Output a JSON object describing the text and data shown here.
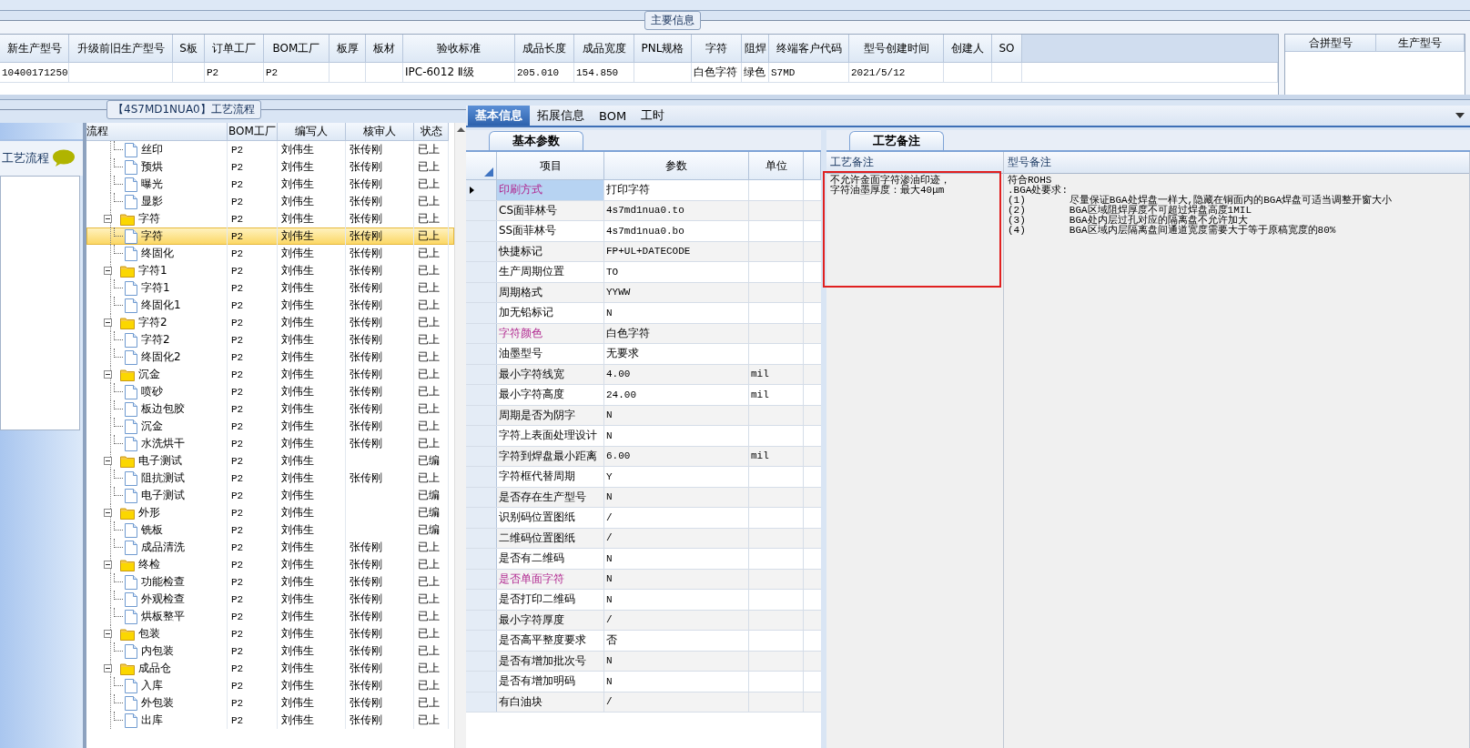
{
  "main_info": {
    "legend": "主要信息",
    "columns": [
      {
        "header": "新生产型号",
        "value": "10400171250"
      },
      {
        "header": "升级前旧生产型号"
      },
      {
        "header": "S板"
      },
      {
        "header": "订单工厂",
        "value": "P2"
      },
      {
        "header": "BOM工厂",
        "value": "P2"
      },
      {
        "header": "板厚"
      },
      {
        "header": "板材"
      },
      {
        "header": "验收标准",
        "value": "IPC-6012 Ⅱ级"
      },
      {
        "header": "成品长度",
        "value": "205.010"
      },
      {
        "header": "成品宽度",
        "value": "154.850"
      },
      {
        "header": "PNL规格"
      },
      {
        "header": "字符",
        "value": "白色字符"
      },
      {
        "header": "阻焊",
        "value": "绿色"
      },
      {
        "header": "终端客户代码",
        "value": "S7MD"
      },
      {
        "header": "型号创建时间",
        "value": "2021/5/12"
      },
      {
        "header": "创建人"
      },
      {
        "header": "SO"
      }
    ],
    "side_columns": [
      "合拼型号",
      "生产型号"
    ]
  },
  "sidebar": {
    "title": "工艺流程"
  },
  "process_flow": {
    "legend": "【4S7MD1NUA0】工艺流程",
    "columns": [
      "流程",
      "BOM工厂",
      "编写人",
      "核审人",
      "状态"
    ],
    "nodes": [
      {
        "children": [
          {
            "label": "丝印",
            "bom": "P2",
            "writer": "刘伟生",
            "reviewer": "张传刚",
            "status": "已上",
            "selected": false
          },
          {
            "label": "预烘",
            "bom": "P2",
            "writer": "刘伟生",
            "reviewer": "张传刚",
            "status": "已上",
            "selected": false
          },
          {
            "label": "曝光",
            "bom": "P2",
            "writer": "刘伟生",
            "reviewer": "张传刚",
            "status": "已上",
            "selected": false
          },
          {
            "label": "显影",
            "bom": "P2",
            "writer": "刘伟生",
            "reviewer": "张传刚",
            "status": "已上",
            "selected": false
          }
        ]
      },
      {
        "label": "字符",
        "bom": "P2",
        "writer": "刘伟生",
        "reviewer": "张传刚",
        "status": "已上",
        "selected": false,
        "expanded": true,
        "children": [
          {
            "label": "字符",
            "bom": "P2",
            "writer": "刘伟生",
            "reviewer": "张传刚",
            "status": "已上",
            "selected": true
          },
          {
            "label": "终固化",
            "bom": "P2",
            "writer": "刘伟生",
            "reviewer": "张传刚",
            "status": "已上",
            "selected": false
          }
        ]
      },
      {
        "label": "字符1",
        "bom": "P2",
        "writer": "刘伟生",
        "reviewer": "张传刚",
        "status": "已上",
        "selected": false,
        "expanded": true,
        "children": [
          {
            "label": "字符1",
            "bom": "P2",
            "writer": "刘伟生",
            "reviewer": "张传刚",
            "status": "已上",
            "selected": false
          },
          {
            "label": "终固化1",
            "bom": "P2",
            "writer": "刘伟生",
            "reviewer": "张传刚",
            "status": "已上",
            "selected": false
          }
        ]
      },
      {
        "label": "字符2",
        "bom": "P2",
        "writer": "刘伟生",
        "reviewer": "张传刚",
        "status": "已上",
        "selected": false,
        "expanded": true,
        "children": [
          {
            "label": "字符2",
            "bom": "P2",
            "writer": "刘伟生",
            "reviewer": "张传刚",
            "status": "已上",
            "selected": false
          },
          {
            "label": "终固化2",
            "bom": "P2",
            "writer": "刘伟生",
            "reviewer": "张传刚",
            "status": "已上",
            "selected": false
          }
        ]
      },
      {
        "label": "沉金",
        "bom": "P2",
        "writer": "刘伟生",
        "reviewer": "张传刚",
        "status": "已上",
        "selected": false,
        "expanded": true,
        "children": [
          {
            "label": "喷砂",
            "bom": "P2",
            "writer": "刘伟生",
            "reviewer": "张传刚",
            "status": "已上",
            "selected": false
          },
          {
            "label": "板边包胶",
            "bom": "P2",
            "writer": "刘伟生",
            "reviewer": "张传刚",
            "status": "已上",
            "selected": false
          },
          {
            "label": "沉金",
            "bom": "P2",
            "writer": "刘伟生",
            "reviewer": "张传刚",
            "status": "已上",
            "selected": false
          },
          {
            "label": "水洗烘干",
            "bom": "P2",
            "writer": "刘伟生",
            "reviewer": "张传刚",
            "status": "已上",
            "selected": false
          }
        ]
      },
      {
        "label": "电子测试",
        "bom": "P2",
        "writer": "刘伟生",
        "status": "已编",
        "selected": false,
        "expanded": true,
        "children": [
          {
            "label": "阻抗测试",
            "bom": "P2",
            "writer": "刘伟生",
            "reviewer": "张传刚",
            "status": "已上",
            "selected": false
          },
          {
            "label": "电子测试",
            "bom": "P2",
            "writer": "刘伟生",
            "status": "已编",
            "selected": false
          }
        ]
      },
      {
        "label": "外形",
        "bom": "P2",
        "writer": "刘伟生",
        "status": "已编",
        "selected": false,
        "expanded": true,
        "children": [
          {
            "label": "铣板",
            "bom": "P2",
            "writer": "刘伟生",
            "status": "已编",
            "selected": false
          },
          {
            "label": "成品清洗",
            "bom": "P2",
            "writer": "刘伟生",
            "reviewer": "张传刚",
            "status": "已上",
            "selected": false
          }
        ]
      },
      {
        "label": "终检",
        "bom": "P2",
        "writer": "刘伟生",
        "reviewer": "张传刚",
        "status": "已上",
        "selected": false,
        "expanded": true,
        "children": [
          {
            "label": "功能检查",
            "bom": "P2",
            "writer": "刘伟生",
            "reviewer": "张传刚",
            "status": "已上",
            "selected": false
          },
          {
            "label": "外观检查",
            "bom": "P2",
            "writer": "刘伟生",
            "reviewer": "张传刚",
            "status": "已上",
            "selected": false
          },
          {
            "label": "烘板整平",
            "bom": "P2",
            "writer": "刘伟生",
            "reviewer": "张传刚",
            "status": "已上",
            "selected": false
          }
        ]
      },
      {
        "label": "包装",
        "bom": "P2",
        "writer": "刘伟生",
        "reviewer": "张传刚",
        "status": "已上",
        "selected": false,
        "expanded": true,
        "children": [
          {
            "label": "内包装",
            "bom": "P2",
            "writer": "刘伟生",
            "reviewer": "张传刚",
            "status": "已上",
            "selected": false
          }
        ]
      },
      {
        "label": "成品仓",
        "bom": "P2",
        "writer": "刘伟生",
        "reviewer": "张传刚",
        "status": "已上",
        "selected": false,
        "expanded": true,
        "children": [
          {
            "label": "入库",
            "bom": "P2",
            "writer": "刘伟生",
            "reviewer": "张传刚",
            "status": "已上",
            "selected": false
          },
          {
            "label": "外包装",
            "bom": "P2",
            "writer": "刘伟生",
            "reviewer": "张传刚",
            "status": "已上",
            "selected": false
          },
          {
            "label": "出库",
            "bom": "P2",
            "writer": "刘伟生",
            "reviewer": "张传刚",
            "status": "已上",
            "selected": false
          }
        ]
      }
    ]
  },
  "detail_tabs": [
    {
      "label": "基本信息",
      "selected": true
    },
    {
      "label": "拓展信息",
      "selected": false
    },
    {
      "label": "BOM",
      "selected": false
    },
    {
      "label": "工时",
      "selected": false
    }
  ],
  "basic_params": {
    "tab": "基本参数",
    "columns": [
      "项目",
      "参数",
      "单位"
    ],
    "rows": [
      {
        "item": "印刷方式",
        "value": "打印字符",
        "emphasized": true,
        "selected": true
      },
      {
        "item": "CS面菲林号",
        "value": "4s7md1nua0.to",
        "emphasized": false,
        "selected": false
      },
      {
        "item": "SS面菲林号",
        "value": "4s7md1nua0.bo",
        "emphasized": false,
        "selected": false
      },
      {
        "item": "快捷标记",
        "value": "FP+UL+DATECODE",
        "emphasized": false,
        "selected": false
      },
      {
        "item": "生产周期位置",
        "value": "TO",
        "emphasized": false,
        "selected": false
      },
      {
        "item": "周期格式",
        "value": "YYWW",
        "emphasized": false,
        "selected": false
      },
      {
        "item": "加无铅标记",
        "value": "N",
        "emphasized": false,
        "selected": false
      },
      {
        "item": "字符颜色",
        "value": "白色字符",
        "emphasized": true,
        "selected": false
      },
      {
        "item": "油墨型号",
        "value": "无要求",
        "emphasized": false,
        "selected": false
      },
      {
        "item": "最小字符线宽",
        "value": "4.00",
        "unit": "mil",
        "emphasized": false,
        "selected": false
      },
      {
        "item": "最小字符高度",
        "value": "24.00",
        "unit": "mil",
        "emphasized": false,
        "selected": false
      },
      {
        "item": "周期是否为阴字",
        "value": "N",
        "emphasized": false,
        "selected": false
      },
      {
        "item": "字符上表面处理设计",
        "value": "N",
        "emphasized": false,
        "selected": false
      },
      {
        "item": "字符到焊盘最小距离",
        "value": "6.00",
        "unit": "mil",
        "emphasized": false,
        "selected": false
      },
      {
        "item": "字符框代替周期",
        "value": "Y",
        "emphasized": false,
        "selected": false
      },
      {
        "item": "是否存在生产型号",
        "value": "N",
        "emphasized": false,
        "selected": false
      },
      {
        "item": "识别码位置图纸",
        "value": "/",
        "emphasized": false,
        "selected": false
      },
      {
        "item": "二维码位置图纸",
        "value": "/",
        "emphasized": false,
        "selected": false
      },
      {
        "item": "是否有二维码",
        "value": "N",
        "emphasized": false,
        "selected": false
      },
      {
        "item": "是否单面字符",
        "value": "N",
        "emphasized": true,
        "selected": false
      },
      {
        "item": "是否打印二维码",
        "value": "N",
        "emphasized": false,
        "selected": false
      },
      {
        "item": "最小字符厚度",
        "value": "/",
        "emphasized": false,
        "selected": false
      },
      {
        "item": "是否高平整度要求",
        "value": "否",
        "emphasized": false,
        "selected": false
      },
      {
        "item": "是否有增加批次号",
        "value": "N",
        "emphasized": false,
        "selected": false
      },
      {
        "item": "是否有增加明码",
        "value": "N",
        "emphasized": false,
        "selected": false
      },
      {
        "item": "有白油块",
        "value": "/",
        "emphasized": false,
        "selected": false
      }
    ]
  },
  "remarks": {
    "tab": "工艺备注",
    "process_header": "工艺备注",
    "process_lines": [
      "不允许金面字符渗油印迹，",
      "字符油墨厚度：最大40μm"
    ],
    "model_header": "型号备注",
    "model_lines": [
      "符合ROHS",
      ".BGA处要求:"
    ],
    "model_items": [
      {
        "num": "(1)",
        "text": "尽量保证BGA处焊盘一样大,隐藏在铜面内的BGA焊盘可适当调整开窗大小"
      },
      {
        "num": "(2)",
        "text": "BGA区域阻焊厚度不可超过焊盘高度1MIL"
      },
      {
        "num": "(3)",
        "text": "BGA处内层过孔对应的隔离盘不允许加大"
      },
      {
        "num": "(4)",
        "text": "BGA区域内层隔离盘间通道宽度需要大于等于原稿宽度的80%"
      }
    ]
  }
}
